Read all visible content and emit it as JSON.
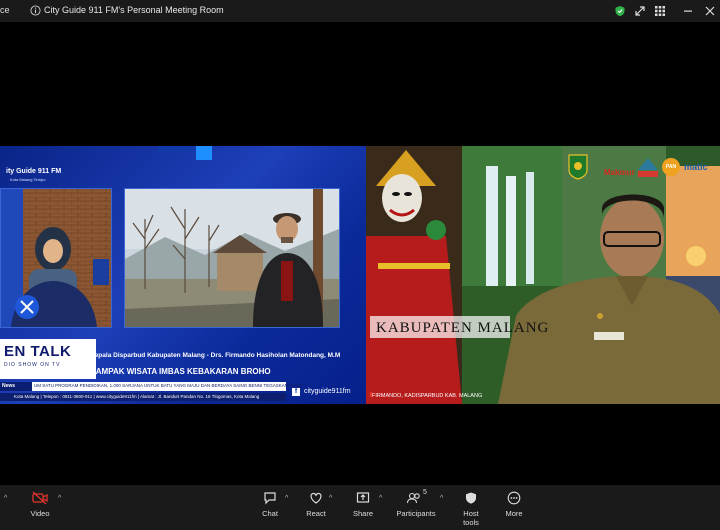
{
  "titlebar": {
    "app_name": "ce",
    "meeting_title": "City Guide 911 FM's Personal Meeting Room"
  },
  "left_video": {
    "brand": "ity Guide 911 FM",
    "brand_tag": "Kota Malang Tempo",
    "talk_title": "EN TALK",
    "talk_sub": "DIO SHOW ON TV",
    "guest": "Kepala Disparbud Kabupaten Malang - Drs. Firmando Hasiholan Matondang, M.M",
    "topic": "DAMPAK WISATA IMBAS KEBAKARAN BROHO",
    "fb_name": "cityguide911fm",
    "news_label": "News",
    "news_ticker": "UM SATU PROGRAM PENDIDIKAN, 1.000 SARJANA UNTUK BATU YANG MAJU DAN BERDAYA SAING  BENNI TEGASKAN KOMIT",
    "contact": "Kota Malang | Telepon : 0811-3600-911 | www.cityguide911fm | Alamat : Jl. Bandurt Pandan No. 16 Tlogomas, Kota Malang"
  },
  "right_video": {
    "banner": "KABUPATEN MALANG",
    "caption": "FIRMANDO, KADISPARBUD KAB. MALANG",
    "logo_makmur": "Makmur",
    "logo_pan": "PAN",
    "logo_matic": "matic"
  },
  "toolbar": {
    "video_label": "Video",
    "chat_label": "Chat",
    "react_label": "React",
    "share_label": "Share",
    "participants_label": "Participants",
    "participants_count": "5",
    "hosttools_label": "Host tools",
    "more_label": "More"
  },
  "colors": {
    "toolbar_bg": "#1a1a1a",
    "accent_red": "#e0342c",
    "shield_green": "#2fb34a"
  }
}
